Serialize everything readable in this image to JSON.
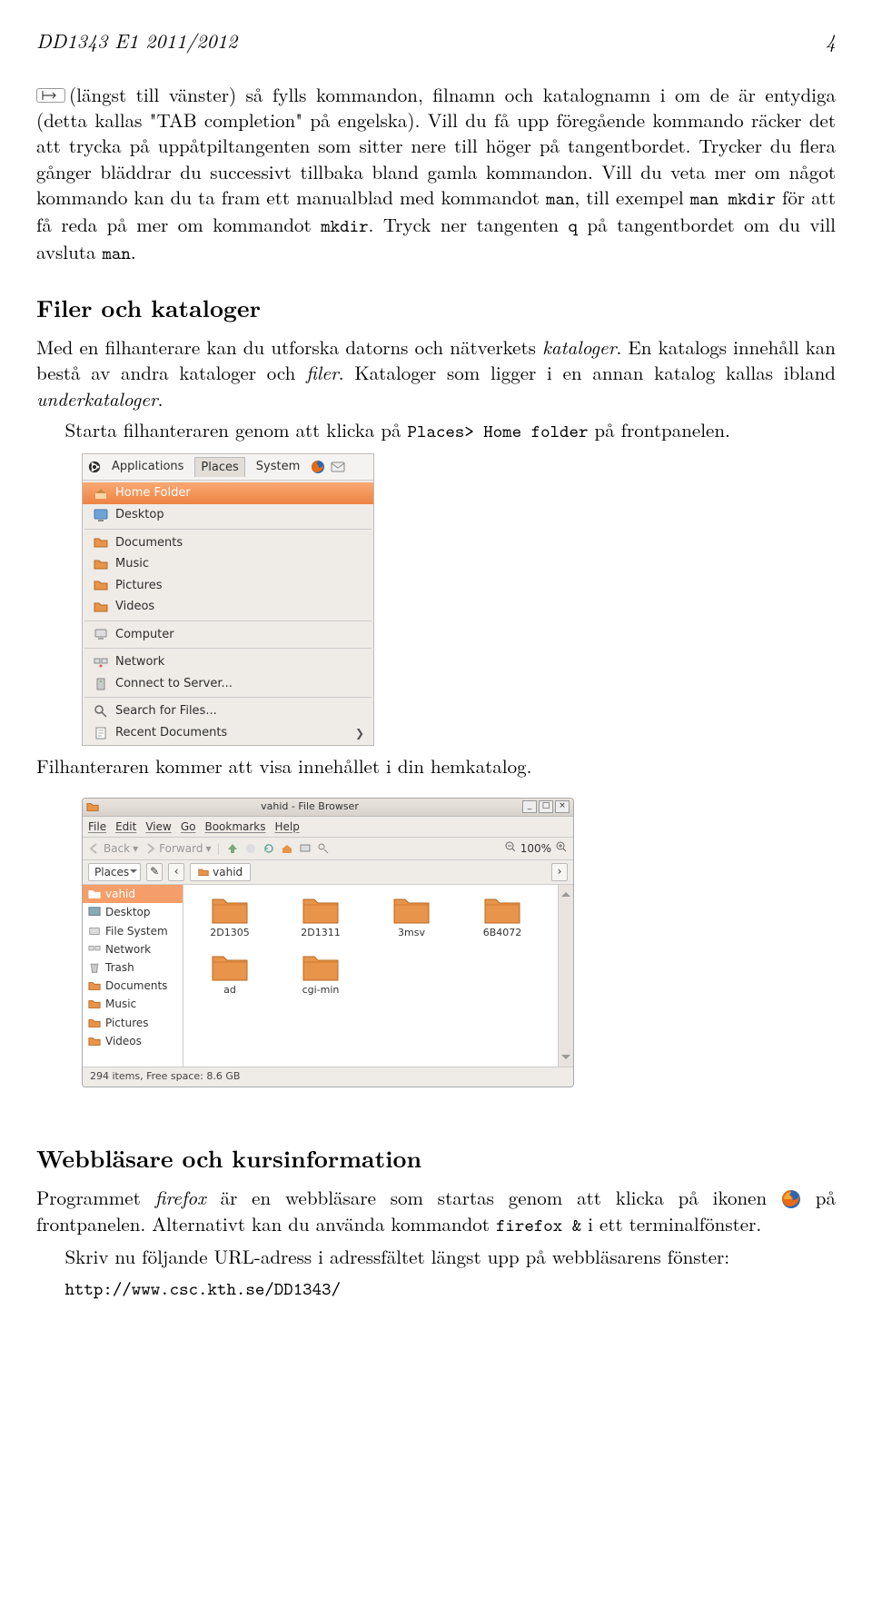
{
  "header": {
    "left": "DD1343 E1 2011/2012",
    "right": "4"
  },
  "para1": {
    "t1": "(längst till vänster) så fylls kommandon, filnamn och katalognamn i om de är entydiga (detta kallas \"TAB completion\" på engelska). Vill du få upp föregående kommando räcker det att trycka på uppåtpiltangenten som sitter nere till höger på tangentbordet. Trycker du flera gånger bläddrar du successivt tillbaka bland gamla kommandon. Vill du veta mer om något kommando kan du ta fram ett manualblad med kommandot ",
    "man": "man",
    "t2": ", till exempel ",
    "manmkdir": "man mkdir",
    "t3": " för att få reda på mer om kommandot ",
    "mkdir": "mkdir",
    "t4": ". Tryck ner tangenten ",
    "q": "q",
    "t5": " på tangentbordet om du vill avsluta ",
    "man2": "man",
    "t6": "."
  },
  "h_files": "Filer och kataloger",
  "para2": {
    "t1": "Med en filhanterare kan du utforska datorns och nätverkets ",
    "kataloger": "kataloger",
    "t2": ". En katalogs innehåll kan bestå av andra kataloger och ",
    "filer": "filer",
    "t3": ". Kataloger som ligger i en annan katalog kallas ibland ",
    "under": "underkataloger",
    "t4": "."
  },
  "para3": {
    "t1": "Starta filhanteraren genom att klicka på ",
    "places": "Places> Home folder",
    "t2": " på frontpanelen."
  },
  "gnome": {
    "top": {
      "applications": "Applications",
      "places": "Places",
      "system": "System"
    },
    "items": [
      "Home Folder",
      "Desktop",
      "Documents",
      "Music",
      "Pictures",
      "Videos"
    ],
    "computer": "Computer",
    "network": "Network",
    "connect": "Connect to Server...",
    "search": "Search for Files...",
    "recent": "Recent Documents"
  },
  "caption_gnome": "Filhanteraren kommer att visa innehållet i din hemkatalog.",
  "fb": {
    "title": "vahid - File Browser",
    "menu": [
      "File",
      "Edit",
      "View",
      "Go",
      "Bookmarks",
      "Help"
    ],
    "back": "Back",
    "forward": "Forward",
    "zoom": "100%",
    "places_dd": "Places",
    "crumb": "vahid",
    "side": [
      "vahid",
      "Desktop",
      "File System",
      "Network",
      "Trash",
      "Documents",
      "Music",
      "Pictures",
      "Videos"
    ],
    "files": [
      "2D1305",
      "2D1311",
      "3msv",
      "6B4072",
      "ad",
      "cgi-min"
    ],
    "status": "294 items, Free space: 8.6 GB"
  },
  "h_web": "Webbläsare och kursinformation",
  "para4": {
    "t1": "Programmet ",
    "firefox": "firefox",
    "t2": " är en webbläsare som startas genom att klicka på ikonen ",
    "t3": " på frontpanelen. Alternativt kan du använda kommandot ",
    "cmd": "firefox &",
    "t4": " i ett terminalfönster."
  },
  "para5": {
    "t1": "Skriv nu följande URL-adress i adressfältet längst upp på webbläsarens fönster:"
  },
  "url": "http://www.csc.kth.se/DD1343/"
}
